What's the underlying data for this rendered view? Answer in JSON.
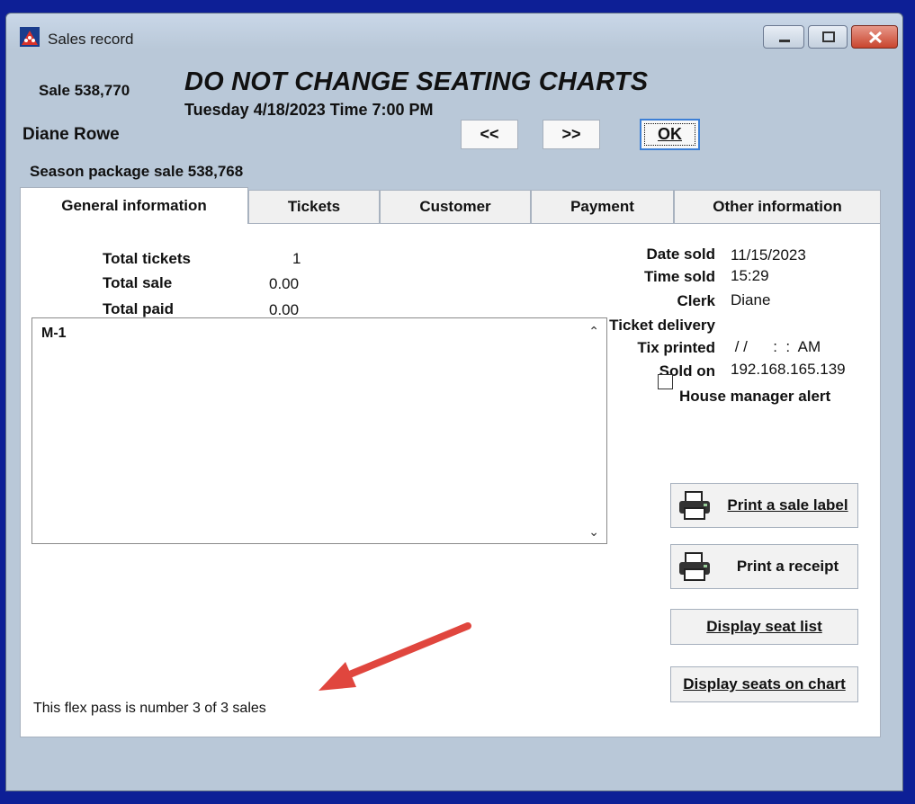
{
  "window": {
    "title": "Sales record"
  },
  "header": {
    "sale_number": "Sale 538,770",
    "event_title": "DO NOT CHANGE SEATING CHARTS",
    "event_date": "Tuesday 4/18/2023  Time 7:00 PM",
    "customer_name": "Diane Rowe",
    "season_package": "Season package sale 538,768"
  },
  "nav": {
    "prev_label": "<<",
    "next_label": ">>",
    "ok_label": "OK"
  },
  "tabs": [
    {
      "label": "General information",
      "active": true
    },
    {
      "label": "Tickets"
    },
    {
      "label": "Customer"
    },
    {
      "label": "Payment"
    },
    {
      "label": "Other information"
    }
  ],
  "totals": {
    "tickets_label": "Total tickets",
    "tickets_value": "1",
    "sale_label": "Total sale",
    "sale_value": "0.00",
    "paid_label": "Total paid",
    "paid_value": "0.00"
  },
  "seats": {
    "text": "M-1"
  },
  "details": {
    "date_sold_label": "Date sold",
    "date_sold_value": "11/15/2023",
    "time_sold_label": "Time sold",
    "time_sold_value": "15:29",
    "clerk_label": "Clerk",
    "clerk_value": "Diane",
    "delivery_label": "Ticket delivery",
    "printed_label": "Tix printed",
    "printed_value": " / /      :  :  AM",
    "sold_on_label": "Sold on",
    "sold_on_value": "192.168.165.139",
    "house_alert_label": "House manager alert"
  },
  "actions": {
    "print_label": "Print a sale label",
    "print_receipt": "Print a receipt",
    "display_seat_list": "Display seat list",
    "display_seats_chart": "Display seats on chart"
  },
  "flex_note": "This flex pass is number 3 of 3 sales",
  "colors": {
    "annotation_arrow": "#e0463e",
    "desktop": "#0d1f96"
  }
}
